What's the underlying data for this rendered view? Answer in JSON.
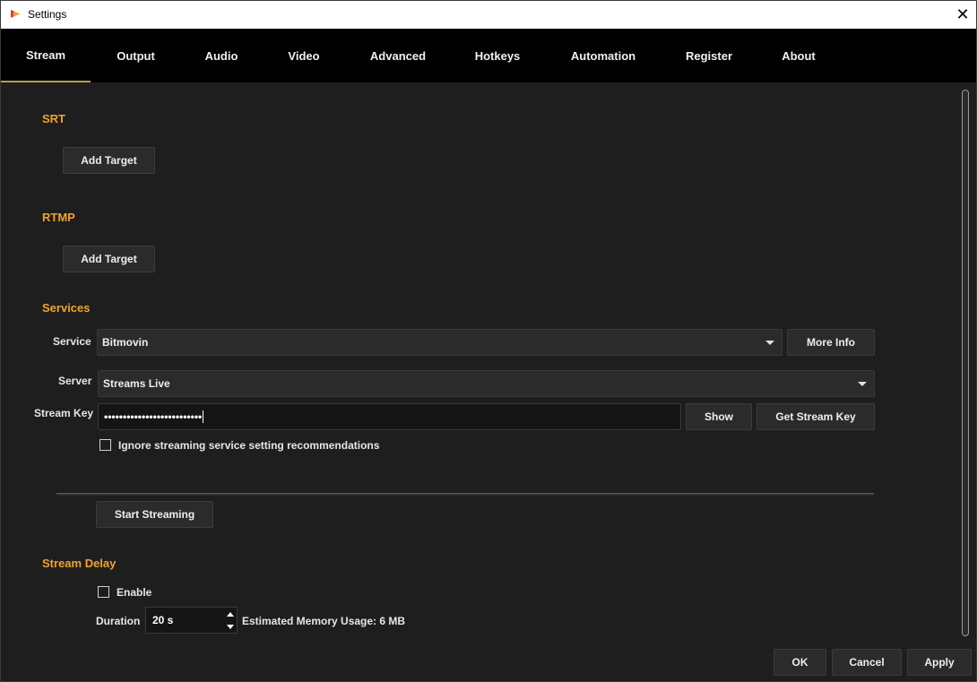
{
  "window": {
    "title": "Settings"
  },
  "tabs": [
    {
      "label": "Stream"
    },
    {
      "label": "Output"
    },
    {
      "label": "Audio"
    },
    {
      "label": "Video"
    },
    {
      "label": "Advanced"
    },
    {
      "label": "Hotkeys"
    },
    {
      "label": "Automation"
    },
    {
      "label": "Register"
    },
    {
      "label": "About"
    }
  ],
  "active_tab": "Stream",
  "srt": {
    "title": "SRT",
    "add_target": "Add Target"
  },
  "rtmp": {
    "title": "RTMP",
    "add_target": "Add Target"
  },
  "services": {
    "title": "Services",
    "service_label": "Service",
    "service_value": "Bitmovin",
    "more_info": "More Info",
    "server_label": "Server",
    "server_value": "Streams Live",
    "stream_key_label": "Stream Key",
    "stream_key_masked": "••••••••••••••••••••••••••",
    "show": "Show",
    "get_stream_key": "Get Stream Key",
    "ignore_label": "Ignore streaming service setting recommendations",
    "ignore_checked": false
  },
  "start_streaming": "Start Streaming",
  "stream_delay": {
    "title": "Stream Delay",
    "enable_label": "Enable",
    "enable_checked": false,
    "duration_label": "Duration",
    "duration_value": "20 s",
    "memory_usage": "Estimated Memory Usage: 6 MB"
  },
  "footer": {
    "ok": "OK",
    "cancel": "Cancel",
    "apply": "Apply"
  },
  "colors": {
    "accent": "#f0a32d",
    "tab_underline": "#b0a050",
    "background": "#1e1e1e"
  }
}
